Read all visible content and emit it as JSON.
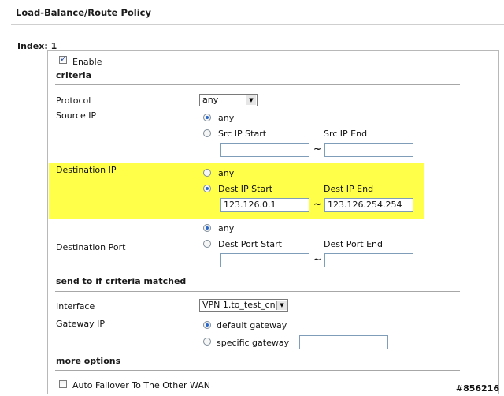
{
  "page_title": "Load-Balance/Route Policy",
  "index_label": "Index: 1",
  "enable": {
    "label": "Enable",
    "checked": true
  },
  "criteria": {
    "section_title": "criteria",
    "protocol": {
      "label": "Protocol",
      "value": "any"
    },
    "source_ip": {
      "label": "Source IP",
      "any_label": "any",
      "range_label": "Src IP Start",
      "end_label": "Src IP End",
      "start_value": "",
      "end_value": "",
      "selected": "any"
    },
    "destination_ip": {
      "label": "Destination IP",
      "any_label": "any",
      "range_label": "Dest IP Start",
      "end_label": "Dest IP End",
      "start_value": "123.126.0.1",
      "end_value": "123.126.254.254",
      "selected": "range"
    },
    "destination_port": {
      "label": "Destination Port",
      "any_label": "any",
      "range_label": "Dest Port Start",
      "end_label": "Dest Port End",
      "start_value": "",
      "end_value": "",
      "selected": "any"
    },
    "range_separator": "~"
  },
  "send_to": {
    "section_title": "send to if criteria matched",
    "interface": {
      "label": "Interface",
      "value": "VPN 1.to_test_cn"
    },
    "gateway_ip": {
      "label": "Gateway IP",
      "default_label": "default gateway",
      "specific_label": "specific gateway",
      "specific_value": "",
      "selected": "default"
    }
  },
  "more_options": {
    "section_title": "more options",
    "auto_failover": {
      "label": "Auto Failover To The Other WAN",
      "checked": false
    }
  },
  "watermark": "#856216",
  "colors": {
    "highlight": "#ffff4a",
    "radio_selected": "#2a67c8"
  }
}
